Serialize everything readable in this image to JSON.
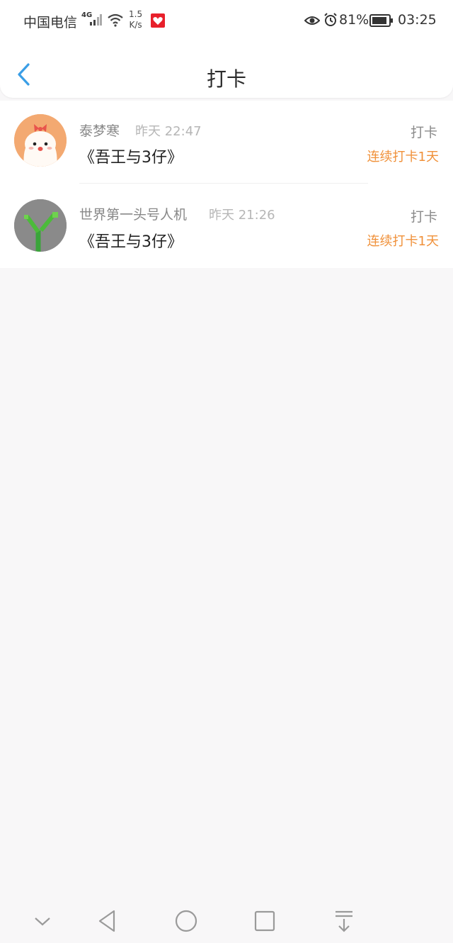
{
  "status_bar": {
    "carrier": "中国电信",
    "network": "4G",
    "speed_value": "1.5",
    "speed_unit": "K/s",
    "battery": "81%",
    "time": "03:25"
  },
  "header": {
    "title": "打卡"
  },
  "entries": [
    {
      "user": "泰梦寒",
      "time": "昨天 22:47",
      "book": "《吾王与3仔》",
      "action": "打卡",
      "streak": "连续打卡1天"
    },
    {
      "user": "世界第一头号人机",
      "time": "昨天 21:26",
      "book": "《吾王与3仔》",
      "action": "打卡",
      "streak": "连续打卡1天"
    }
  ],
  "colors": {
    "accent_blue": "#3a9ee6",
    "streak_orange": "#f0913a",
    "background": "#f8f7f8"
  }
}
